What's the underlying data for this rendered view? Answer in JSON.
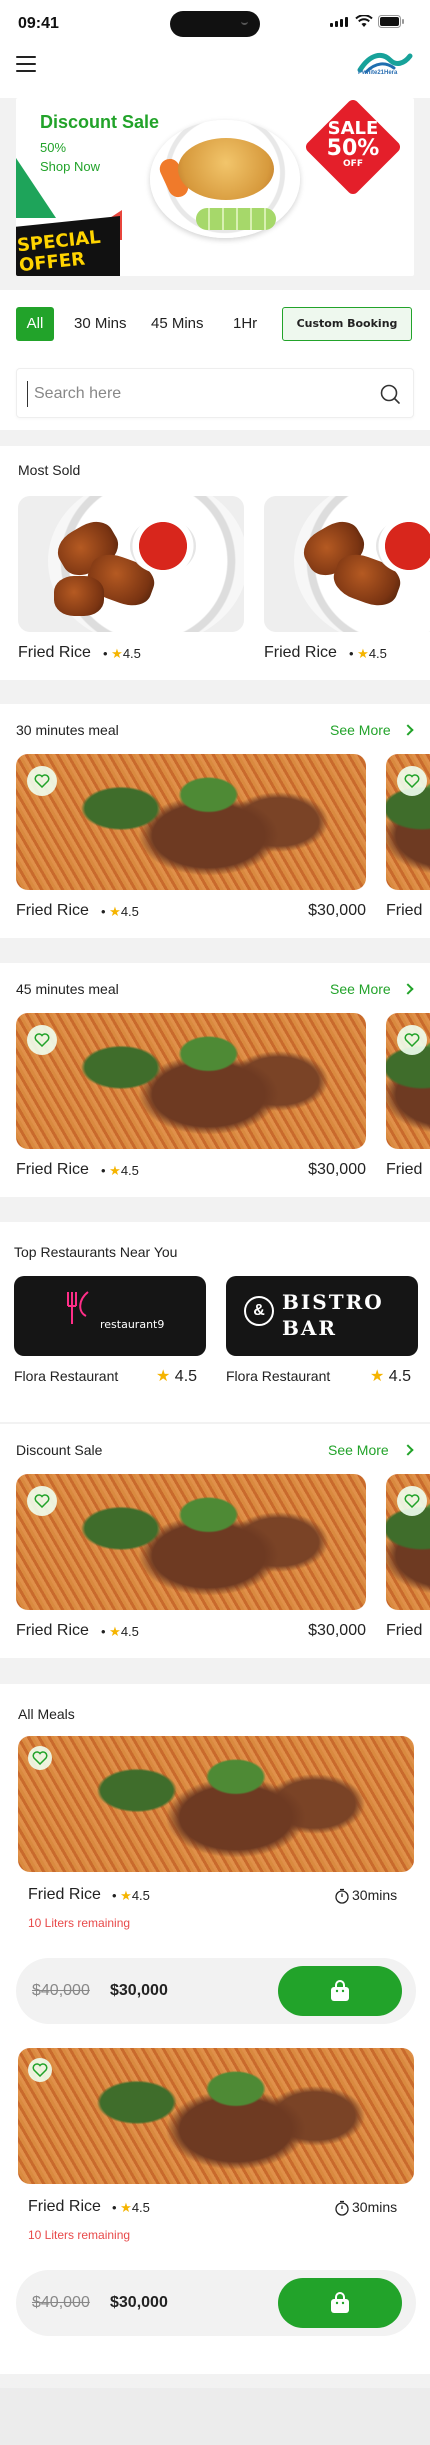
{
  "status": {
    "time": "09:41"
  },
  "header": {
    "menu_icon": "hamburger-menu-icon",
    "logo_text": "Pwhite21Hera"
  },
  "banner": {
    "title": "Discount Sale",
    "percent": "50%",
    "cta": "Shop Now",
    "sale_line1": "SALE",
    "sale_line2": "50%",
    "sale_line3": "OFF",
    "special_line1": "SPECIAL",
    "special_line2": "OFFER"
  },
  "filters": {
    "chips": [
      "All",
      "30 Mins",
      "45 Mins",
      "1Hr"
    ],
    "custom": "Custom Booking",
    "active": "All"
  },
  "search": {
    "placeholder": "Search here"
  },
  "most_sold": {
    "title": "Most Sold",
    "items": [
      {
        "name": "Fried Rice",
        "rating": "4.5"
      },
      {
        "name": "Fried Rice",
        "rating": "4.5"
      }
    ]
  },
  "meal30": {
    "title": "30 minutes meal",
    "see_more": "See More",
    "items": [
      {
        "name": "Fried Rice",
        "rating": "4.5",
        "price": "$30,000"
      },
      {
        "name": "Fried"
      }
    ]
  },
  "meal45": {
    "title": "45 minutes meal",
    "see_more": "See More",
    "items": [
      {
        "name": "Fried Rice",
        "rating": "4.5",
        "price": "$30,000"
      },
      {
        "name": "Fried"
      }
    ]
  },
  "restaurants": {
    "title": "Top Restaurants Near You",
    "items": [
      {
        "logo_text": "restaurant9",
        "name": "Flora  Restaurant",
        "rating": "4.5"
      },
      {
        "logo_line1": "BISTRO",
        "logo_line2": "BAR",
        "name": "Flora  Restaurant",
        "rating": "4.5"
      }
    ]
  },
  "discount": {
    "title": "Discount Sale",
    "see_more": "See More",
    "items": [
      {
        "name": "Fried Rice",
        "rating": "4.5",
        "price": "$30,000"
      },
      {
        "name": "Fried"
      }
    ]
  },
  "all_meals": {
    "title": "All Meals",
    "items": [
      {
        "name": "Fried Rice",
        "rating": "4.5",
        "time": "30mins",
        "remaining": "10 Liters remaining",
        "old_price": "$40,000",
        "price": "$30,000"
      },
      {
        "name": "Fried Rice",
        "rating": "4.5",
        "time": "30mins",
        "remaining": "10 Liters remaining",
        "old_price": "$40,000",
        "price": "$30,000"
      }
    ]
  },
  "colors": {
    "accent": "#22a32a",
    "danger": "#e84a4a",
    "star": "#f5b400"
  }
}
